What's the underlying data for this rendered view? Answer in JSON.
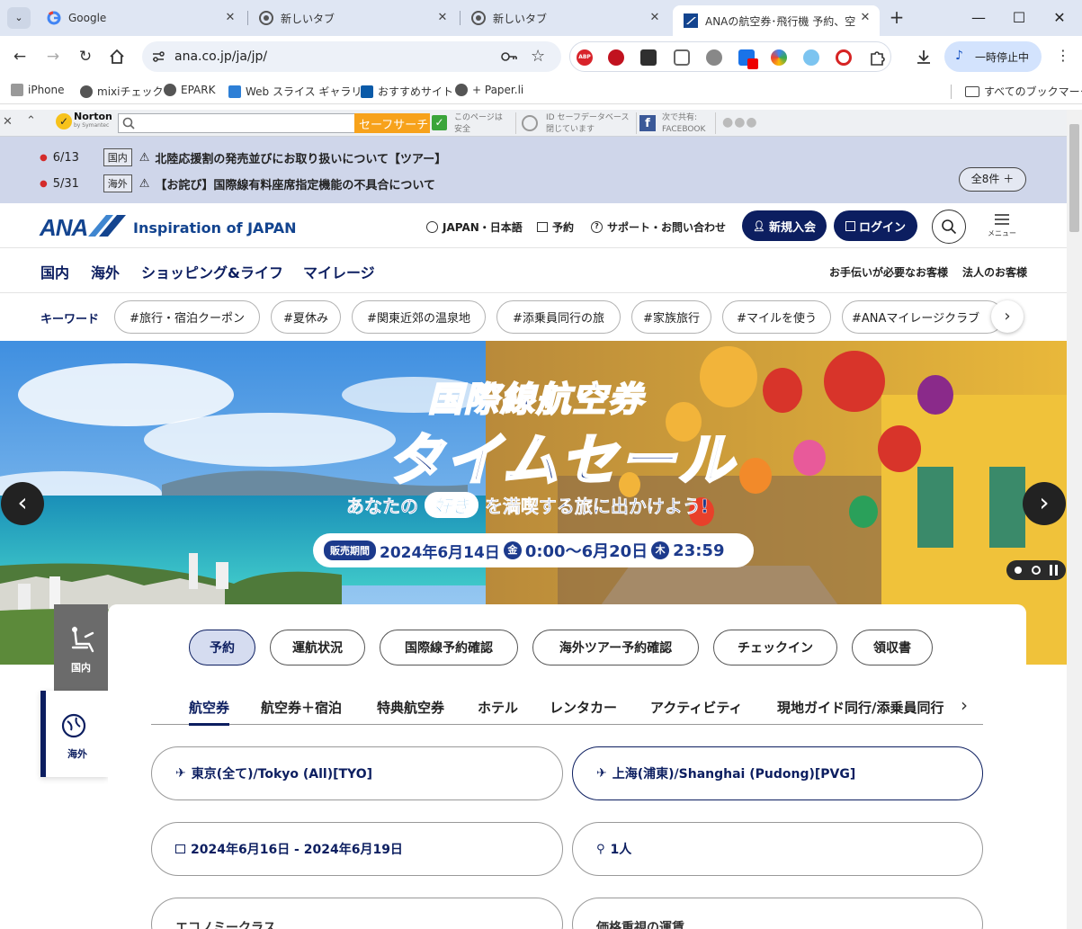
{
  "browser": {
    "tabs": [
      {
        "title": "Google",
        "icon": "google-icon"
      },
      {
        "title": "新しいタブ",
        "icon": "chrome-icon"
      },
      {
        "title": "新しいタブ",
        "icon": "chrome-icon"
      },
      {
        "title": "ANAの航空券･飛行機 予約、空",
        "icon": "ana-favicon"
      }
    ],
    "url": "ana.co.jp/ja/jp/",
    "pause_label": "一時停止中",
    "bookmarks": [
      {
        "label": "iPhone"
      },
      {
        "label": "mixiチェック"
      },
      {
        "label": "EPARK"
      },
      {
        "label": "Web スライス ギャラリー"
      },
      {
        "label": "おすすめサイト"
      },
      {
        "label": "+ Paper.li"
      }
    ],
    "all_bookmarks": "すべてのブックマーク"
  },
  "norton": {
    "logo": "Norton",
    "logo_sub": "by Symantec",
    "search_button": "セーフサーチ",
    "safe_line1": "このページは",
    "safe_line2": "安全",
    "idsafe_line1": "ID セーフデータベース",
    "idsafe_line2": "閉じています",
    "share_line1": "次で共有:",
    "share_line2": "FACEBOOK"
  },
  "notices": {
    "items": [
      {
        "date": "6/13",
        "category": "国内",
        "text": "北陸応援割の発売並びにお取り扱いについて【ツアー】"
      },
      {
        "date": "5/31",
        "category": "海外",
        "text": "【お詫び】国際線有料座席指定機能の不具合について"
      }
    ],
    "all_label": "全8件 ＋"
  },
  "header": {
    "logo": "ANA",
    "tagline": "Inspiration of JAPAN",
    "region": "JAPAN・日本語",
    "reserve": "予約",
    "support": "サポート・お問い合わせ",
    "signup": "新規入会",
    "login": "ログイン",
    "menu": "メニュー"
  },
  "gnav": {
    "items": [
      "国内",
      "海外",
      "ショッピング&ライフ",
      "マイレージ"
    ],
    "help": "お手伝いが必要なお客様",
    "corporate": "法人のお客様"
  },
  "keywords": {
    "label": "キーワード",
    "items": [
      "#旅行・宿泊クーポン",
      "#夏休み",
      "#関東近郊の温泉地",
      "#添乗員同行の旅",
      "#家族旅行",
      "#マイルを使う",
      "#ANAマイレージクラブ"
    ]
  },
  "hero": {
    "title1": "国際線航空券",
    "title2": "タイムセール",
    "subtitle_pre": "あなたの",
    "subtitle_mid": "好き",
    "subtitle_post": "を満喫する旅に出かけよう!",
    "period_label": "販売期間",
    "period_a": "2024年6月14日",
    "day_a": "金",
    "time_a": "0:00～6月20日",
    "day_b": "木",
    "time_b": "23:59"
  },
  "side": {
    "domestic": "国内",
    "international": "海外"
  },
  "booking": {
    "tabs": [
      "予約",
      "運航状況",
      "国際線予約確認",
      "海外ツアー予約確認",
      "チェックイン",
      "領収書"
    ],
    "subtabs": [
      "航空券",
      "航空券＋宿泊",
      "特典航空券",
      "ホテル",
      "レンタカー",
      "アクティビティ",
      "現地ガイド同行/添乗員同行"
    ],
    "from": "東京(全て)/Tokyo (All)[TYO]",
    "to": "上海(浦東)/Shanghai (Pudong)[PVG]",
    "dates": "2024年6月16日 - 2024年6月19日",
    "passengers": "1人",
    "cabin": "エコノミークラス",
    "fare": "価格重視の運賃"
  }
}
